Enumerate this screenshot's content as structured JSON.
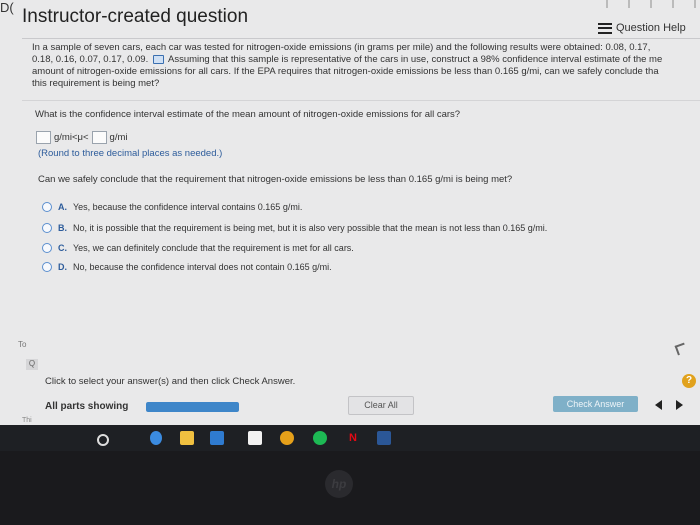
{
  "window": {
    "tab_fragment": "D(",
    "title": "Instructor-created question",
    "help_label": "Question Help"
  },
  "problem": {
    "line1": "In a sample of seven cars, each car was tested for nitrogen-oxide emissions (in grams per mile) and the following results were obtained: 0.08, 0.17,",
    "line2a": "0.18, 0.16, 0.07, 0.17, 0.09.",
    "line2b": "Assuming that this sample is representative of the cars in use, construct a 98% confidence interval estimate of the me",
    "line3": "amount of nitrogen-oxide emissions for all cars. If the EPA requires that nitrogen-oxide emissions be less than 0.165 g/mi, can we safely conclude tha",
    "line4": "this requirement is being met?"
  },
  "question1": {
    "prompt": "What is the confidence interval estimate of the mean amount of nitrogen-oxide emissions for all cars?",
    "middle_text": "g/mi<μ<",
    "unit_text": "g/mi",
    "hint": "(Round to three decimal places as needed.)"
  },
  "question2": {
    "prompt": "Can we safely conclude that the requirement that nitrogen-oxide emissions be less than 0.165 g/mi is being met?",
    "options": [
      {
        "letter": "A.",
        "text": "Yes, because the confidence interval contains 0.165 g/mi."
      },
      {
        "letter": "B.",
        "text": "No, it is possible that the requirement is being met, but it is also very possible that the mean is not less than 0.165 g/mi."
      },
      {
        "letter": "C.",
        "text": "Yes, we can definitely conclude that the requirement is met for all cars."
      },
      {
        "letter": "D.",
        "text": "No, because the confidence interval does not contain 0.165 g/mi."
      }
    ]
  },
  "side": {
    "to_label": "To",
    "q_label": "Q"
  },
  "footer": {
    "instruction": "Click to select your answer(s) and then click Check Answer.",
    "parts_label": "All parts showing",
    "progress_fraction": 1.0,
    "clear_label": "Clear All",
    "check_label": "Check Answer",
    "help_symbol": "?",
    "this_fragment": "Thi"
  },
  "taskbar": {
    "icons": [
      "start-icon",
      "edge-icon",
      "file-explorer-icon",
      "store-icon",
      "amazon-icon",
      "chrome-icon",
      "spotify-icon",
      "netflix-icon",
      "word-icon"
    ],
    "colors": {
      "chrome": "#e5a01a",
      "spotify": "#1db954",
      "netflix": "#e50914",
      "word": "#2b5797",
      "edge": "#3b8be0"
    }
  },
  "brand": "hp"
}
